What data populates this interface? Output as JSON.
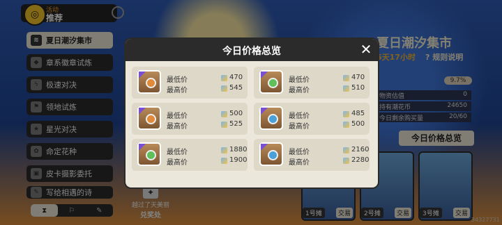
{
  "header": {
    "event_small": "活动",
    "event_main": "推荐"
  },
  "sidebar": {
    "items": [
      {
        "label": "夏日潮汐集市",
        "icon": "shop-icon",
        "active": true
      },
      {
        "label": "章系徽章试炼",
        "icon": "badge-icon",
        "active": false
      },
      {
        "label": "极速对决",
        "icon": "lightning-icon",
        "active": false
      },
      {
        "label": "领地试炼",
        "icon": "flag-icon",
        "active": false
      },
      {
        "label": "星光对决",
        "icon": "star-icon",
        "active": false
      },
      {
        "label": "命定花种",
        "icon": "flower-icon",
        "active": false
      },
      {
        "label": "皮卡摄影委托",
        "icon": "camera-icon",
        "active": false
      },
      {
        "label": "写给相遇的诗",
        "icon": "pen-icon",
        "active": false
      }
    ],
    "bottom_tabs": [
      "⧗",
      "⚐",
      "✎"
    ]
  },
  "background_panel": {
    "title": "夏日潮汐集市",
    "time_left": "5天17小时",
    "rules_link": "? 规则说明",
    "percent": "9.7%",
    "rows": [
      {
        "label": "物资估值",
        "value": "0"
      },
      {
        "label": "持有潮花币",
        "value": "24650"
      },
      {
        "label": "今日剩余购买量",
        "value": "20/60"
      }
    ],
    "today_price_button": "今日价格总览",
    "stalls": [
      {
        "label": "1号摊",
        "tag": "交易"
      },
      {
        "label": "2号摊",
        "tag": "交易"
      },
      {
        "label": "3号摊",
        "tag": "交易"
      }
    ],
    "exchange": {
      "line1": "越过了天美丽",
      "line2": "兑奖处"
    },
    "uid": "34327731"
  },
  "modal": {
    "title": "今日价格总览",
    "min_label": "最低价",
    "max_label": "最高价",
    "colors": {
      "gem_green": "#5fbf5a",
      "gem_orange": "#e08a3a",
      "gem_blue": "#4aa0d8",
      "tier_purple": "#7a4fd6"
    },
    "items": [
      {
        "gem": "gem_orange",
        "min": "470",
        "max": "545"
      },
      {
        "gem": "gem_green",
        "min": "470",
        "max": "510"
      },
      {
        "gem": "gem_orange",
        "min": "500",
        "max": "525"
      },
      {
        "gem": "gem_blue",
        "min": "485",
        "max": "500"
      },
      {
        "gem": "gem_green",
        "min": "1880",
        "max": "1900"
      },
      {
        "gem": "gem_blue",
        "min": "2160",
        "max": "2280"
      }
    ]
  }
}
